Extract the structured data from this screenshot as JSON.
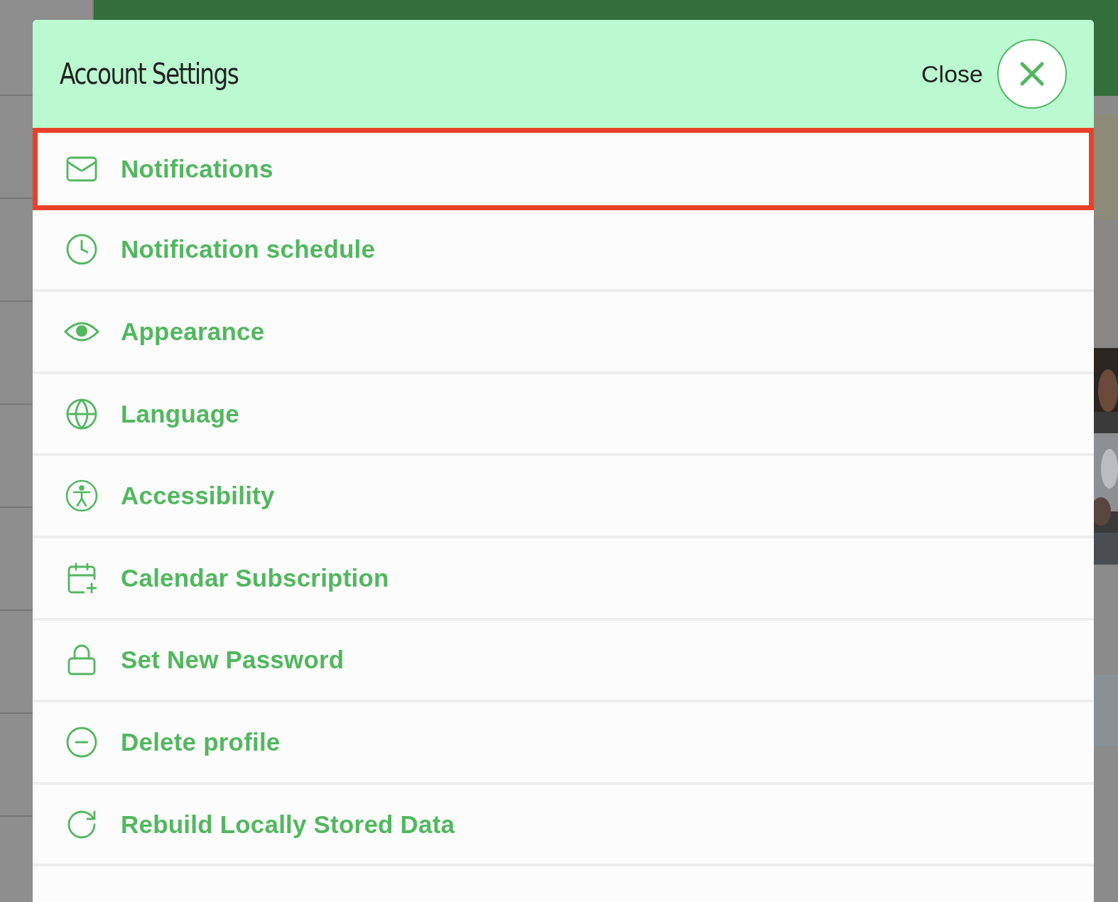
{
  "dialog": {
    "title": "Account Settings",
    "close_label": "Close"
  },
  "items": [
    {
      "label": "Notifications",
      "highlighted": true
    },
    {
      "label": "Notification schedule",
      "highlighted": false
    },
    {
      "label": "Appearance",
      "highlighted": false
    },
    {
      "label": "Language",
      "highlighted": false
    },
    {
      "label": "Accessibility",
      "highlighted": false
    },
    {
      "label": "Calendar Subscription",
      "highlighted": false
    },
    {
      "label": "Set New Password",
      "highlighted": false
    },
    {
      "label": "Delete profile",
      "highlighted": false
    },
    {
      "label": "Rebuild Locally Stored Data",
      "highlighted": false
    }
  ]
}
